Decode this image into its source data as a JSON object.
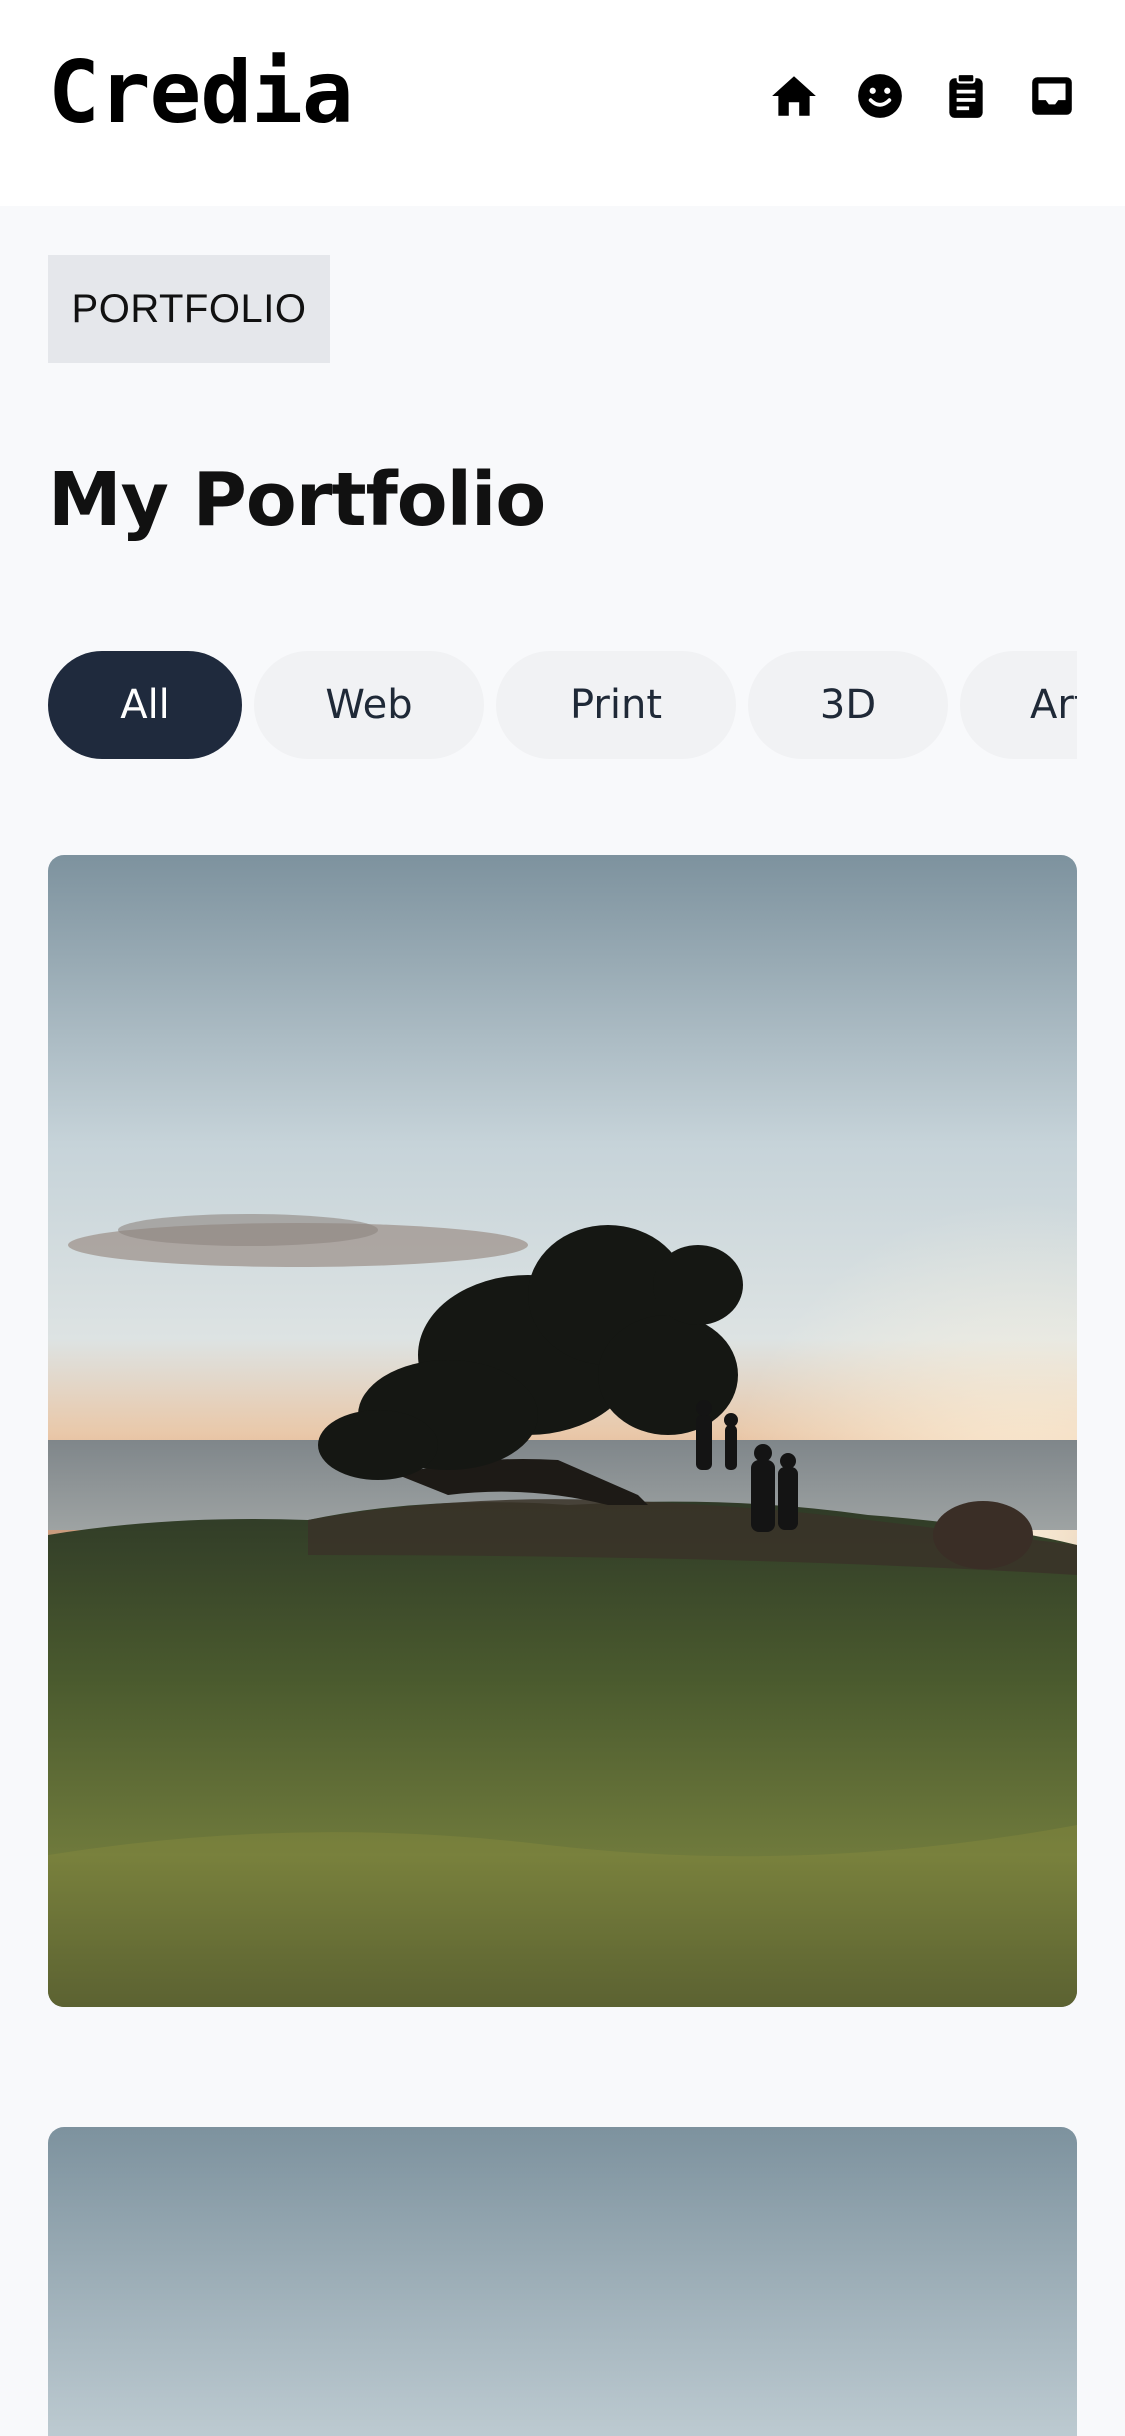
{
  "header": {
    "logo": "Credia",
    "icons": [
      "home-icon",
      "smiley-icon",
      "clipboard-icon",
      "inbox-icon"
    ]
  },
  "badge": "PORTFOLIO",
  "page_title": "My Portfolio",
  "filters": [
    {
      "label": "All",
      "active": true
    },
    {
      "label": "Web",
      "active": false
    },
    {
      "label": "Print",
      "active": false
    },
    {
      "label": "3D",
      "active": false
    },
    {
      "label": "Art",
      "active": false
    }
  ],
  "colors": {
    "header_bg": "#ffffff",
    "page_bg": "#f8f9fb",
    "chip_active": "#1f2a3d",
    "chip_inactive": "#f1f2f4",
    "badge_bg": "#e5e7eb"
  },
  "gallery": [
    {
      "name": "sunset-tree-photo"
    },
    {
      "name": "sky-photo"
    }
  ]
}
